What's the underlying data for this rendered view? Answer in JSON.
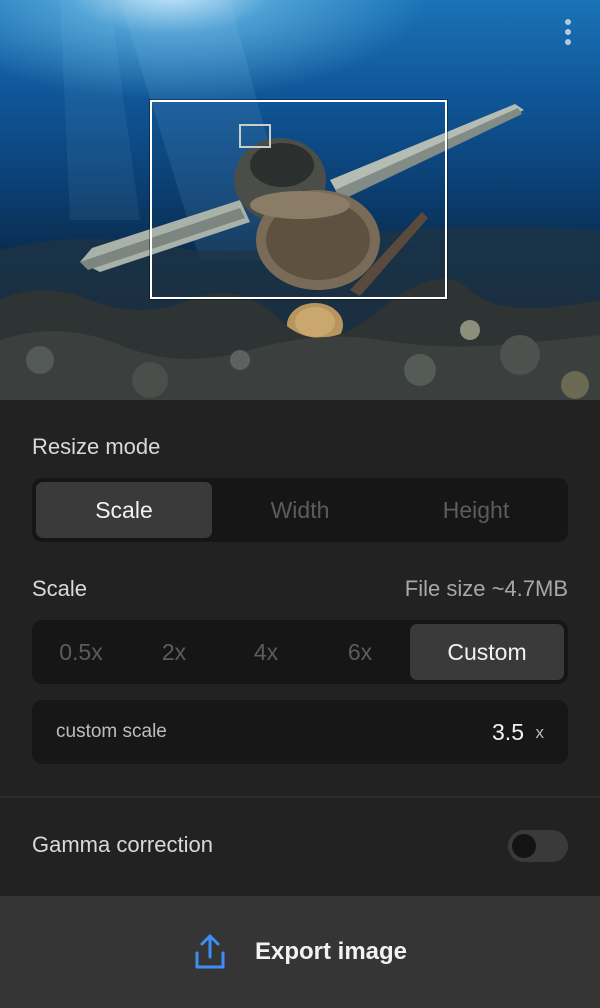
{
  "preview": {
    "menu_icon": "more-vertical-icon",
    "subject": "underwater plane wreck"
  },
  "resize_mode": {
    "label": "Resize mode",
    "options": [
      "Scale",
      "Width",
      "Height"
    ],
    "selected": "Scale"
  },
  "scale": {
    "label": "Scale",
    "file_size": "File size ~4.7MB",
    "options": [
      "0.5x",
      "2x",
      "4x",
      "6x",
      "Custom"
    ],
    "selected": "Custom",
    "custom": {
      "label": "custom scale",
      "value": "3.5",
      "unit": "x"
    }
  },
  "gamma": {
    "label": "Gamma correction",
    "enabled": false
  },
  "export": {
    "label": "Export image",
    "icon": "share-upload-icon",
    "accent": "#3f8ef5"
  },
  "colors": {
    "panel_bg": "#222222",
    "segment_bg": "#161616",
    "active_segment": "#3a3a3a",
    "export_bar": "#353535"
  }
}
